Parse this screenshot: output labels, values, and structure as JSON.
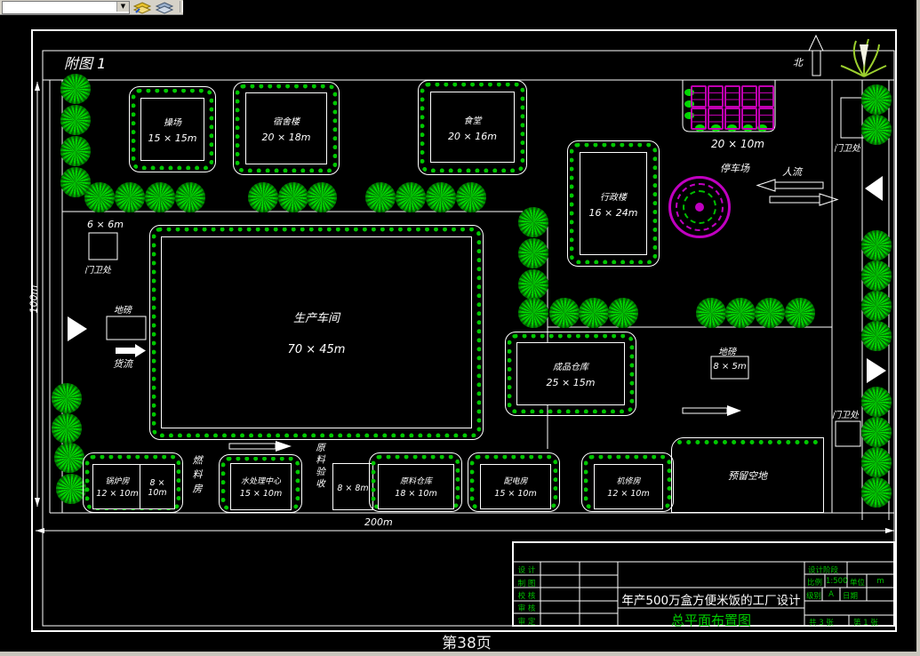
{
  "window": {
    "page_footer": "第38页"
  },
  "drawing": {
    "figure_label": "附图 1",
    "north_label": "北",
    "dim_width": "200m",
    "dim_height": "100m"
  },
  "buildings": [
    {
      "name": "操场",
      "dims": "15 × 15m"
    },
    {
      "name": "宿舍楼",
      "dims": "20 × 18m"
    },
    {
      "name": "食堂",
      "dims": "20 × 16m"
    },
    {
      "name": "行政楼",
      "dims": "16 × 24m"
    },
    {
      "name": "生产车间",
      "dims": "70 × 45m"
    },
    {
      "name": "成品仓库",
      "dims": "25 × 15m"
    },
    {
      "name": "锅炉房",
      "dims": "12 × 10m"
    },
    {
      "name": "",
      "dims": "8 × 10m"
    },
    {
      "name": "水处理中心",
      "dims": "15 × 10m"
    },
    {
      "name": "",
      "dims": "8 × 8m"
    },
    {
      "name": "原料仓库",
      "dims": "18 × 10m"
    },
    {
      "name": "配电房",
      "dims": "15 × 10m"
    },
    {
      "name": "机修房",
      "dims": "12 × 10m"
    }
  ],
  "site_labels": {
    "parking_dims": "20 × 10m",
    "parking": "停车场",
    "people_flow": "人流",
    "goods_flow": "货流",
    "gate_tl_dims": "6 × 6m",
    "gate_tl": "门卫处",
    "gate_tr": "门卫处",
    "gate_br": "门卫处",
    "weighbridge_left": "地磅",
    "weighbridge_right": "地磅",
    "weighbridge_right_dims": "8 × 5m",
    "fuel_room": "燃料房",
    "material_acceptance": "原料验收",
    "reserved_land": "预留空地"
  },
  "title_block": {
    "sign_rows": [
      "设 计",
      "制 图",
      "校 核",
      "审 核",
      "审 定"
    ],
    "project_title": "年产500万盒方便米饭的工厂设计",
    "drawing_title": "总平面布置图",
    "stage_label": "设计阶段",
    "scale_label": "比例",
    "scale_value": "1:500",
    "unit_label": "单位",
    "unit_value": "m",
    "grade_label": "级别",
    "grade_value": "A",
    "date_label": "日期",
    "total_sheets": "共 3 张",
    "sheet_number": "第 1 张"
  },
  "colors": {
    "background": "#000000",
    "line_white": "#ffffff",
    "tree_green": "#00d400",
    "annotation_green": "#00c000",
    "car_magenta": "#c000b0"
  }
}
